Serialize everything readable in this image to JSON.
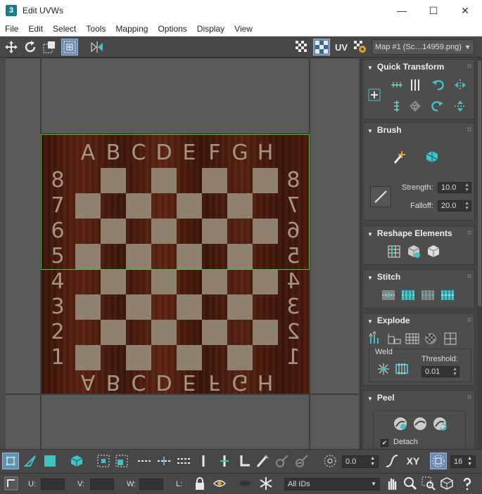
{
  "window": {
    "app_icon": "3",
    "title": "Edit UVWs",
    "minimize": "—",
    "maximize": "☐",
    "close": "✕"
  },
  "menu": [
    "File",
    "Edit",
    "Select",
    "Tools",
    "Mapping",
    "Options",
    "Display",
    "View"
  ],
  "toolbar": {
    "uv_label": "UV",
    "map_select": "Map #1 (Sc…14959.png)"
  },
  "board": {
    "columns": [
      "A",
      "B",
      "C",
      "D",
      "E",
      "F",
      "G",
      "H"
    ],
    "rows": [
      "8",
      "7",
      "6",
      "5",
      "4",
      "3",
      "2",
      "1"
    ]
  },
  "panel": {
    "quick_transform": "Quick Transform",
    "brush": "Brush",
    "strength_label": "Strength:",
    "strength_value": "10.0",
    "falloff_label": "Falloff:",
    "falloff_value": "20.0",
    "reshape": "Reshape Elements",
    "stitch": "Stitch",
    "explode": "Explode",
    "weld": "Weld",
    "threshold_label": "Threshold:",
    "threshold_value": "0.01",
    "peel": "Peel",
    "detach_label": "Detach",
    "detach_checked": "✔"
  },
  "bottom": {
    "rotate_value": "0.0",
    "xy_label": "XY",
    "count_value": "16",
    "u_label": "U:",
    "v_label": "V:",
    "w_label": "W:",
    "l_label": "L:",
    "ids_select": "All IDs"
  },
  "colors": {
    "accent_teal": "#3fc3c9",
    "selection_green": "#39d23a",
    "active_blue": "#6b8cb0"
  }
}
